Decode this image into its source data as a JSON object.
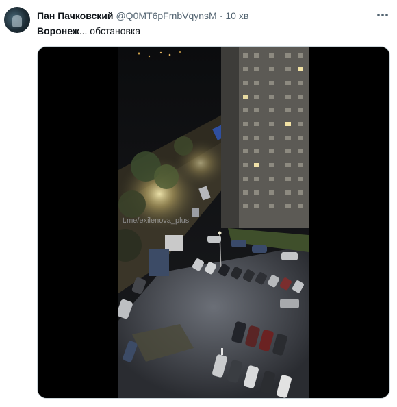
{
  "author": {
    "display_name": "Пан Пачковский",
    "handle": "@Q0MT6pFmbVqynsM",
    "separator": "·",
    "time": "10 хв",
    "avatar_icon": "avatar-image"
  },
  "more_icon": "more-horizontal-icon",
  "tweet": {
    "text_bold": "Воронеж",
    "text_rest": "... обстановка"
  },
  "media": {
    "kind": "video",
    "watermark": "t.me/exilenova_plus",
    "description_icon": "night-street-video"
  },
  "colors": {
    "text_primary": "#0f1419",
    "text_secondary": "#536471",
    "media_border": "#cfd9de",
    "media_background": "#000000"
  }
}
